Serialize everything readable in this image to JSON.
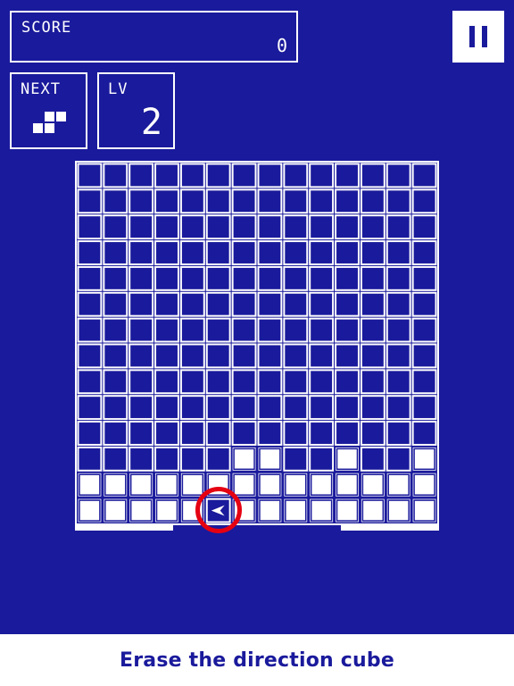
{
  "score": {
    "label": "SCORE",
    "value": "0"
  },
  "next": {
    "label": "NEXT",
    "piece_cells": [
      [
        1,
        0
      ],
      [
        2,
        0
      ],
      [
        0,
        1
      ],
      [
        1,
        1
      ]
    ]
  },
  "level": {
    "label": "LV",
    "value": "2"
  },
  "pause": {
    "icon": "pause-icon"
  },
  "board": {
    "columns": 14,
    "rows": 14,
    "solid_cells": [
      [
        6,
        11
      ],
      [
        7,
        11
      ],
      [
        10,
        11
      ],
      [
        13,
        11
      ],
      [
        0,
        12
      ],
      [
        1,
        12
      ],
      [
        2,
        12
      ],
      [
        3,
        12
      ],
      [
        4,
        12
      ],
      [
        5,
        12
      ],
      [
        6,
        12
      ],
      [
        7,
        12
      ],
      [
        8,
        12
      ],
      [
        9,
        12
      ],
      [
        10,
        12
      ],
      [
        11,
        12
      ],
      [
        12,
        12
      ],
      [
        13,
        12
      ],
      [
        0,
        13
      ],
      [
        1,
        13
      ],
      [
        2,
        13
      ],
      [
        3,
        13
      ],
      [
        4,
        13
      ],
      [
        6,
        13
      ],
      [
        7,
        13
      ],
      [
        8,
        13
      ],
      [
        9,
        13
      ],
      [
        10,
        13
      ],
      [
        11,
        13
      ],
      [
        12,
        13
      ],
      [
        13,
        13
      ]
    ],
    "direction_cube": {
      "col": 5,
      "row": 13,
      "glyph": "➤",
      "direction": "left"
    }
  },
  "hint": {
    "text": "Erase the direction cube"
  },
  "colors": {
    "background": "#1a1a9c",
    "foreground": "#ffffff",
    "highlight": "#e50012"
  }
}
